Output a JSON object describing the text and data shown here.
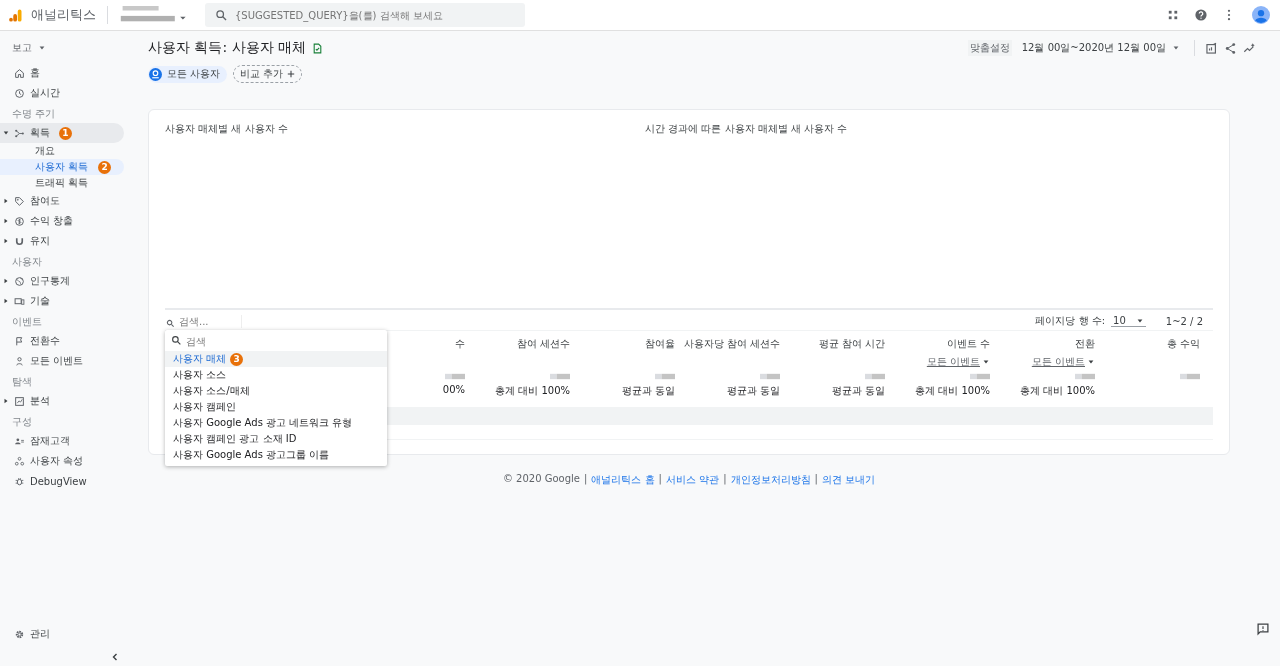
{
  "header": {
    "app_name": "애널리틱스",
    "search_placeholder": "{SUGGESTED_QUERY}을(를) 검색해 보세요"
  },
  "sidebar": {
    "menu_label": "보고",
    "sections": [
      {
        "items": [
          {
            "label": "홈",
            "selected": false
          },
          {
            "label": "실시간",
            "selected": false
          }
        ]
      },
      {
        "label": "수명 주기",
        "items": [
          {
            "label": "획득",
            "selected": false,
            "expanded": true,
            "badge": "1",
            "children": [
              {
                "label": "개요",
                "selected": false
              },
              {
                "label": "사용자 획득",
                "selected": true,
                "badge": "2"
              },
              {
                "label": "트래픽 획득",
                "selected": false
              }
            ]
          },
          {
            "label": "참여도",
            "selected": false,
            "expanded": false
          },
          {
            "label": "수익 창출",
            "selected": false,
            "expanded": false
          },
          {
            "label": "유지",
            "selected": false,
            "expanded": false
          }
        ]
      },
      {
        "label": "사용자",
        "items": [
          {
            "label": "인구통계",
            "selected": false,
            "expanded": false
          },
          {
            "label": "기술",
            "selected": false,
            "expanded": false
          }
        ]
      },
      {
        "label": "이벤트",
        "items": [
          {
            "label": "전환수",
            "selected": false
          },
          {
            "label": "모든 이벤트",
            "selected": false
          }
        ]
      },
      {
        "label": "탐색",
        "items": [
          {
            "label": "분석",
            "selected": false,
            "expanded": false
          }
        ]
      },
      {
        "label": "구성",
        "items": [
          {
            "label": "잠재고객",
            "selected": false
          },
          {
            "label": "사용자 속성",
            "selected": false
          },
          {
            "label": "DebugView",
            "selected": false
          }
        ]
      }
    ],
    "admin": "관리"
  },
  "page": {
    "title": "사용자 획득: 사용자 매체",
    "chips": [
      {
        "label": "모든 사용자"
      }
    ],
    "compare_button": "비교 추가",
    "date_label": "맞춤설정",
    "date_range": "12월 00일~2020년 12월 00일"
  },
  "card": {
    "chart_titles": [
      "사용자 매체별 새 사용자 수",
      "시간 경과에 따른 사용자 매체별 새 사용자 수"
    ],
    "table": {
      "search_placeholder": "검색...",
      "rows_per_page_label": "페이지당 행 수:",
      "rows_per_page": "10",
      "pagination": "1~2 / 2",
      "columns": [
        {
          "label": "수",
          "note": "00%"
        },
        {
          "label": "참여 세션수",
          "note": "총계 대비 100%"
        },
        {
          "label": "참여율",
          "note": "평균과 동일"
        },
        {
          "label": "사용자당 참여 세션수",
          "note": "평균과 동일"
        },
        {
          "label": "평균 참여 시간",
          "note": "평균과 동일"
        },
        {
          "label": "이벤트 수",
          "filter": "모든 이벤트",
          "note": "총계 대비 100%"
        },
        {
          "label": "전환",
          "filter": "모든 이벤트",
          "note": "총계 대비 100%"
        },
        {
          "label": "총 수익"
        }
      ]
    },
    "dimension_menu": {
      "search_placeholder": "검색",
      "items": [
        {
          "label": "사용자 매체",
          "selected": true,
          "badge": "3"
        },
        {
          "label": "사용자 소스",
          "selected": false
        },
        {
          "label": "사용자 소스/매체",
          "selected": false
        },
        {
          "label": "사용자 캠페인",
          "selected": false
        },
        {
          "label": "사용자 Google Ads 광고 네트워크 유형",
          "selected": false
        },
        {
          "label": "사용자 캠페인 광고 소재 ID",
          "selected": false
        },
        {
          "label": "사용자 Google Ads 광고그룹 이름",
          "selected": false
        }
      ]
    }
  },
  "footer": [
    {
      "kind": "text",
      "text": "© 2020 Google"
    },
    {
      "kind": "sep",
      "text": "|"
    },
    {
      "kind": "link",
      "text": "애널리틱스 홈"
    },
    {
      "kind": "sep",
      "text": "|"
    },
    {
      "kind": "link",
      "text": "서비스 약관"
    },
    {
      "kind": "sep",
      "text": "|"
    },
    {
      "kind": "link",
      "text": "개인정보처리방침"
    },
    {
      "kind": "sep",
      "text": "|"
    },
    {
      "kind": "link",
      "text": "의견 보내기"
    }
  ]
}
